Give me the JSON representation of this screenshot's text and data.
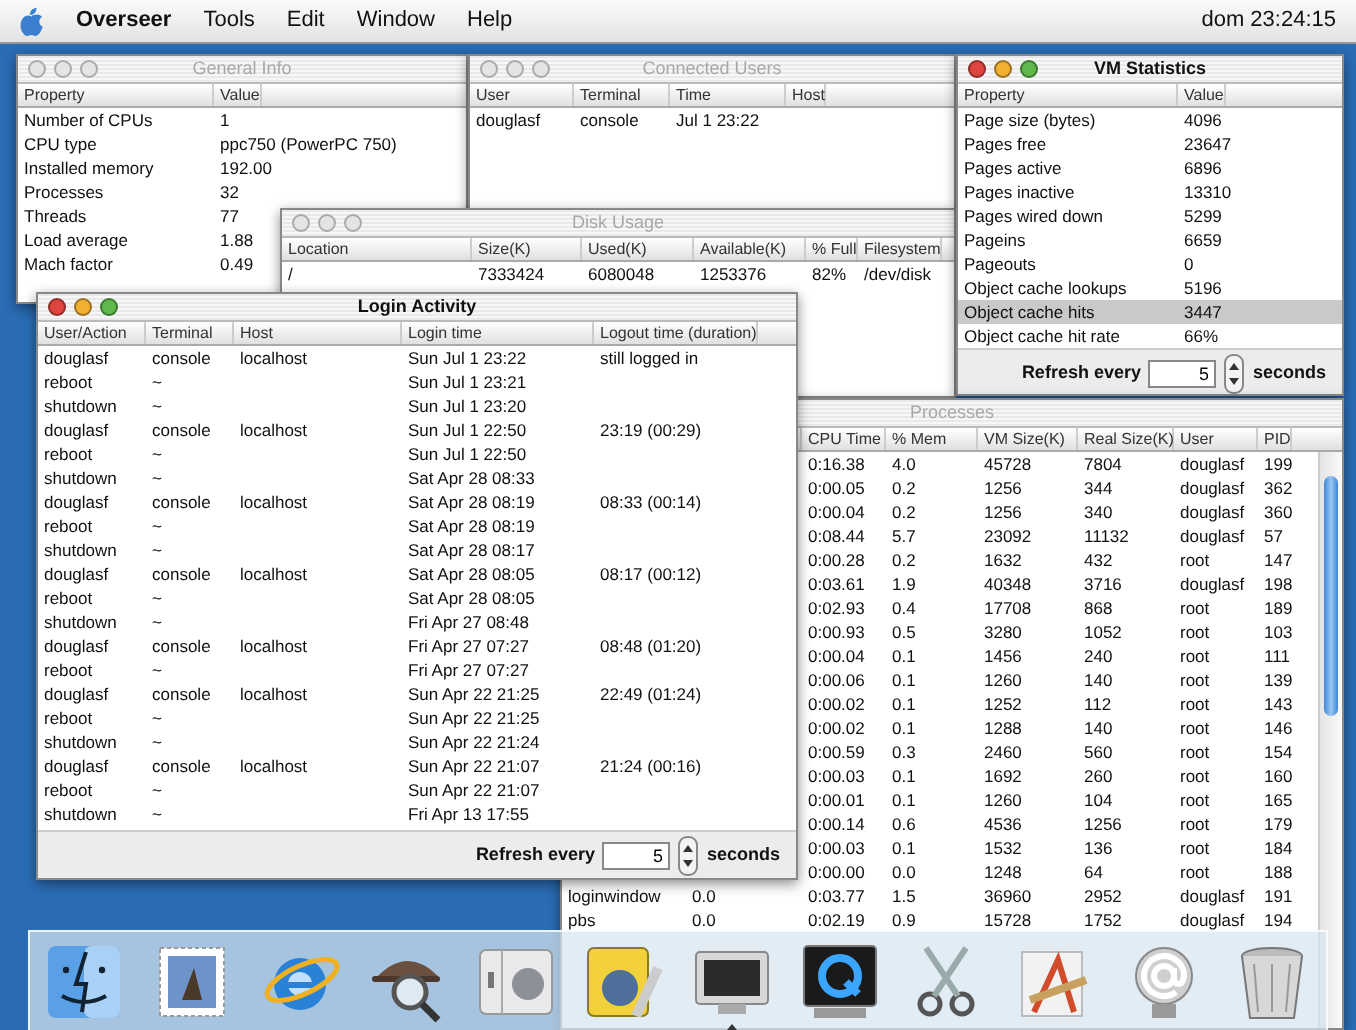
{
  "menu_bar": {
    "app": "Overseer",
    "items": [
      "Tools",
      "Edit",
      "Window",
      "Help"
    ],
    "clock": "dom 23:24:15"
  },
  "windows": [
    {
      "title": "General Info",
      "active": false,
      "columns": [
        "Property",
        "Value"
      ],
      "rows": [
        {
          "cells": [
            "Number of CPUs",
            "1"
          ]
        },
        {
          "cells": [
            "CPU type",
            "ppc750 (PowerPC 750)"
          ]
        },
        {
          "cells": [
            "Installed memory",
            "192.00"
          ]
        },
        {
          "cells": [
            "Processes",
            "32"
          ]
        },
        {
          "cells": [
            "Threads",
            "77"
          ]
        },
        {
          "cells": [
            "Load average",
            "1.88"
          ]
        },
        {
          "cells": [
            "Mach factor",
            "0.49"
          ]
        }
      ]
    },
    {
      "title": "Connected Users",
      "active": false,
      "columns": [
        "User",
        "Terminal",
        "Time",
        "Host"
      ],
      "rows": [
        {
          "cells": [
            "douglasf",
            "console",
            "Jul 1 23:22",
            null
          ]
        }
      ]
    },
    {
      "title": "Disk Usage",
      "active": false,
      "columns": [
        "Location",
        "Size(K)",
        "Used(K)",
        "Available(K)",
        "% Full",
        "Filesystem"
      ],
      "rows": [
        {
          "cells": [
            "/",
            "7333424",
            "6080048",
            "1253376",
            "82%",
            "/dev/disk"
          ]
        }
      ]
    },
    {
      "title": "VM Statistics",
      "active": true,
      "columns": [
        "Property",
        "Value"
      ],
      "rows": [
        {
          "cells": [
            "Page size (bytes)",
            "4096"
          ],
          "selected": false
        },
        {
          "cells": [
            "Pages free",
            "23647"
          ],
          "selected": false
        },
        {
          "cells": [
            "Pages active",
            "6896"
          ],
          "selected": false
        },
        {
          "cells": [
            "Pages inactive",
            "13310"
          ],
          "selected": false
        },
        {
          "cells": [
            "Pages wired down",
            "5299"
          ],
          "selected": false
        },
        {
          "cells": [
            "Pageins",
            "6659"
          ],
          "selected": false
        },
        {
          "cells": [
            "Pageouts",
            "0"
          ],
          "selected": false
        },
        {
          "cells": [
            "Object cache lookups",
            "5196"
          ],
          "selected": false
        },
        {
          "cells": [
            "Object cache hits",
            "3447"
          ],
          "selected": true
        },
        {
          "cells": [
            "Object cache hit rate",
            "66%"
          ],
          "selected": false
        }
      ],
      "refresh": {
        "label": "Refresh every",
        "value": "5",
        "unit": "seconds"
      }
    },
    {
      "title": "Processes",
      "active": false,
      "scrollbar": true,
      "columns": [
        null,
        null,
        "CPU Time",
        "% Mem",
        "VM Size(K)",
        "Real Size(K)",
        "User",
        "PID"
      ],
      "rows": [
        {
          "cells": [
            null,
            null,
            "0:16.38",
            "4.0",
            "45728",
            "7804",
            "douglasf",
            "199"
          ]
        },
        {
          "cells": [
            null,
            null,
            "0:00.05",
            "0.2",
            "1256",
            "344",
            "douglasf",
            "362"
          ]
        },
        {
          "cells": [
            null,
            null,
            "0:00.04",
            "0.2",
            "1256",
            "340",
            "douglasf",
            "360"
          ]
        },
        {
          "cells": [
            null,
            null,
            "0:08.44",
            "5.7",
            "23092",
            "11132",
            "douglasf",
            "57"
          ]
        },
        {
          "cells": [
            null,
            null,
            "0:00.28",
            "0.2",
            "1632",
            "432",
            "root",
            "147"
          ]
        },
        {
          "cells": [
            null,
            null,
            "0:03.61",
            "1.9",
            "40348",
            "3716",
            "douglasf",
            "198"
          ]
        },
        {
          "cells": [
            null,
            null,
            "0:02.93",
            "0.4",
            "17708",
            "868",
            "root",
            "189"
          ]
        },
        {
          "cells": [
            null,
            null,
            "0:00.93",
            "0.5",
            "3280",
            "1052",
            "root",
            "103"
          ]
        },
        {
          "cells": [
            null,
            null,
            "0:00.04",
            "0.1",
            "1456",
            "240",
            "root",
            "111"
          ]
        },
        {
          "cells": [
            null,
            null,
            "0:00.06",
            "0.1",
            "1260",
            "140",
            "root",
            "139"
          ]
        },
        {
          "cells": [
            null,
            null,
            "0:00.02",
            "0.1",
            "1252",
            "112",
            "root",
            "143"
          ]
        },
        {
          "cells": [
            null,
            null,
            "0:00.02",
            "0.1",
            "1288",
            "140",
            "root",
            "146"
          ]
        },
        {
          "cells": [
            null,
            null,
            "0:00.59",
            "0.3",
            "2460",
            "560",
            "root",
            "154"
          ]
        },
        {
          "cells": [
            null,
            null,
            "0:00.03",
            "0.1",
            "1692",
            "260",
            "root",
            "160"
          ]
        },
        {
          "cells": [
            null,
            null,
            "0:00.01",
            "0.1",
            "1260",
            "104",
            "root",
            "165"
          ]
        },
        {
          "cells": [
            null,
            null,
            "0:00.14",
            "0.6",
            "4536",
            "1256",
            "root",
            "179"
          ]
        },
        {
          "cells": [
            null,
            null,
            "0:00.03",
            "0.1",
            "1532",
            "136",
            "root",
            "184"
          ]
        },
        {
          "cells": [
            null,
            null,
            "0:00.00",
            "0.0",
            "1248",
            "64",
            "root",
            "188"
          ]
        },
        {
          "cells": [
            "loginwindow",
            "0.0",
            "0:03.77",
            "1.5",
            "36960",
            "2952",
            "douglasf",
            "191"
          ]
        },
        {
          "cells": [
            "pbs",
            "0.0",
            "0:02.19",
            "0.9",
            "15728",
            "1752",
            "douglasf",
            "194"
          ]
        }
      ]
    },
    {
      "title": "Login Activity",
      "active": true,
      "columns": [
        "User/Action",
        "Terminal",
        "Host",
        "Login time",
        "Logout time (duration)"
      ],
      "rows": [
        {
          "cells": [
            "douglasf",
            "console",
            "localhost",
            "Sun Jul 1 23:22",
            "still logged in"
          ]
        },
        {
          "cells": [
            "reboot",
            "~",
            null,
            "Sun Jul 1 23:21",
            null
          ]
        },
        {
          "cells": [
            "shutdown",
            "~",
            null,
            "Sun Jul 1 23:20",
            null
          ]
        },
        {
          "cells": [
            "douglasf",
            "console",
            "localhost",
            "Sun Jul 1 22:50",
            "23:19 (00:29)"
          ]
        },
        {
          "cells": [
            "reboot",
            "~",
            null,
            "Sun Jul 1 22:50",
            null
          ]
        },
        {
          "cells": [
            "shutdown",
            "~",
            null,
            "Sat Apr 28 08:33",
            null
          ]
        },
        {
          "cells": [
            "douglasf",
            "console",
            "localhost",
            "Sat Apr 28 08:19",
            "08:33 (00:14)"
          ]
        },
        {
          "cells": [
            "reboot",
            "~",
            null,
            "Sat Apr 28 08:19",
            null
          ]
        },
        {
          "cells": [
            "shutdown",
            "~",
            null,
            "Sat Apr 28 08:17",
            null
          ]
        },
        {
          "cells": [
            "douglasf",
            "console",
            "localhost",
            "Sat Apr 28 08:05",
            "08:17 (00:12)"
          ]
        },
        {
          "cells": [
            "reboot",
            "~",
            null,
            "Sat Apr 28 08:05",
            null
          ]
        },
        {
          "cells": [
            "shutdown",
            "~",
            null,
            "Fri Apr 27 08:48",
            null
          ]
        },
        {
          "cells": [
            "douglasf",
            "console",
            "localhost",
            "Fri Apr 27 07:27",
            "08:48 (01:20)"
          ]
        },
        {
          "cells": [
            "reboot",
            "~",
            null,
            "Fri Apr 27 07:27",
            null
          ]
        },
        {
          "cells": [
            "douglasf",
            "console",
            "localhost",
            "Sun Apr 22 21:25",
            "22:49 (01:24)"
          ]
        },
        {
          "cells": [
            "reboot",
            "~",
            null,
            "Sun Apr 22 21:25",
            null
          ]
        },
        {
          "cells": [
            "shutdown",
            "~",
            null,
            "Sun Apr 22 21:24",
            null
          ]
        },
        {
          "cells": [
            "douglasf",
            "console",
            "localhost",
            "Sun Apr 22 21:07",
            "21:24 (00:16)"
          ]
        },
        {
          "cells": [
            "reboot",
            "~",
            null,
            "Sun Apr 22 21:07",
            null
          ]
        },
        {
          "cells": [
            "shutdown",
            "~",
            null,
            "Fri Apr 13 17:55",
            null
          ]
        }
      ],
      "refresh": {
        "label": "Refresh every",
        "value": "5",
        "unit": "seconds"
      }
    }
  ],
  "dock": [
    {
      "kind": "finder"
    },
    {
      "kind": "mail"
    },
    {
      "kind": "browser"
    },
    {
      "kind": "sherlock"
    },
    {
      "kind": "prefs"
    },
    {
      "kind": "web"
    },
    {
      "kind": "monitor",
      "running": true
    },
    {
      "kind": "quicktime"
    },
    {
      "kind": "scissors"
    },
    {
      "kind": "builder"
    },
    {
      "kind": "at"
    },
    {
      "kind": "trash"
    }
  ]
}
